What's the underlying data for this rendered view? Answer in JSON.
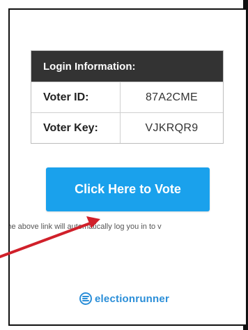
{
  "login": {
    "header": "Login Information:",
    "rows": [
      {
        "label": "Voter ID:",
        "value": "87A2CME"
      },
      {
        "label": "Voter Key:",
        "value": "VJKRQR9"
      }
    ]
  },
  "vote_button": {
    "label": "Click Here to Vote",
    "color": "#1aa1ec"
  },
  "notice_text": "ng the above link will automatically log you in to v",
  "logo": {
    "text": "electionrunner",
    "icon": "electionrunner-logo-icon",
    "color": "#2a8ed8"
  },
  "annotation": {
    "arrow_color": "#d0202a",
    "icon": "red-arrow-annotation"
  }
}
